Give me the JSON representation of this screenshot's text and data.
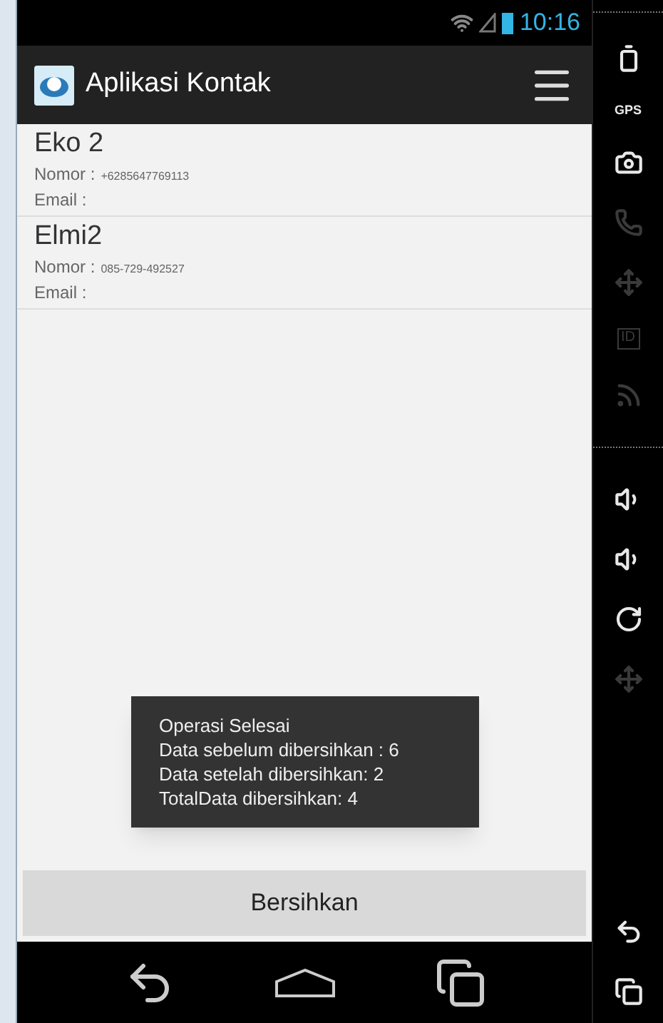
{
  "status_bar": {
    "time": "10:16"
  },
  "action_bar": {
    "title": "Aplikasi Kontak"
  },
  "contacts": [
    {
      "name": "Eko 2",
      "number_label": "Nomor :",
      "number": "+6285647769113",
      "email_label": "Email :"
    },
    {
      "name": "Elmi2",
      "number_label": "Nomor :",
      "number": "085-729-492527",
      "email_label": "Email :"
    }
  ],
  "toast": {
    "lines": [
      "Operasi Selesai",
      "Data sebelum dibersihkan : 6",
      "Data setelah dibersihkan: 2",
      "TotalData dibersihkan: 4"
    ]
  },
  "clean_button": {
    "label": "Bersihkan"
  },
  "emulator_controls": [
    {
      "kind": "battery",
      "disabled": false
    },
    {
      "kind": "gps",
      "label": "GPS",
      "disabled": false
    },
    {
      "kind": "camera",
      "disabled": false
    },
    {
      "kind": "phone",
      "disabled": true
    },
    {
      "kind": "dpad",
      "disabled": true
    },
    {
      "kind": "id",
      "label": "ID",
      "disabled": true
    },
    {
      "kind": "rss",
      "disabled": true
    },
    {
      "kind": "separator"
    },
    {
      "kind": "volume_up",
      "disabled": false
    },
    {
      "kind": "volume_down",
      "disabled": false
    },
    {
      "kind": "rotate",
      "disabled": false
    },
    {
      "kind": "dpad",
      "disabled": true
    },
    {
      "kind": "spacer"
    },
    {
      "kind": "back",
      "disabled": false
    },
    {
      "kind": "recents",
      "disabled": false
    }
  ]
}
